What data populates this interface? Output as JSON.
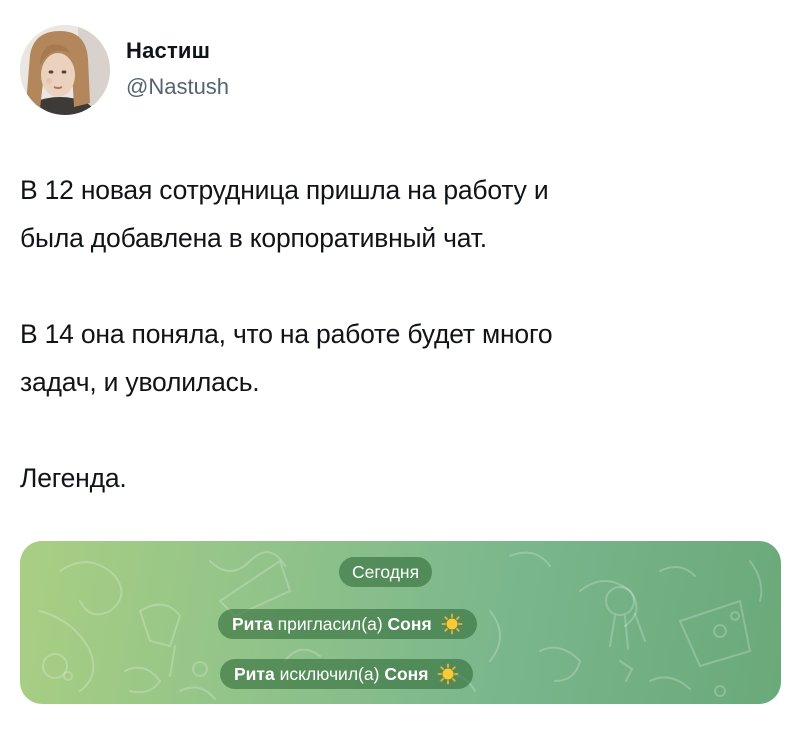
{
  "author": {
    "display_name": "Настиш",
    "handle": "@Nastush"
  },
  "tweet": {
    "paragraph_1_line_1": "В 12 новая сотрудница пришла на работу и",
    "paragraph_1_line_2": "была добавлена в корпоративный чат.",
    "paragraph_2_line_1": "В 14 она поняла, что на работе будет много",
    "paragraph_2_line_2": "задач, и уволилась.",
    "paragraph_3": "Легенда."
  },
  "chat": {
    "date_label": "Сегодня",
    "events": [
      {
        "actor": "Рита",
        "action": "пригласил(а)",
        "target": "Соня"
      },
      {
        "actor": "Рита",
        "action": "исключил(а)",
        "target": "Соня"
      }
    ],
    "target_emoji": "sun-icon",
    "colors": {
      "background_start": "#a9cf83",
      "background_end": "#6aa979",
      "pill": "#346e3c"
    }
  }
}
